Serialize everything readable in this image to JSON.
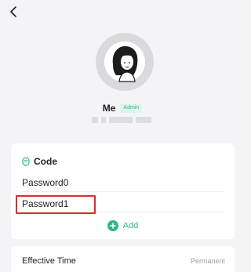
{
  "header": {
    "back_icon": "chevron-left-icon"
  },
  "profile": {
    "name": "Me",
    "role_badge": "Admin",
    "avatar_icon": "user-avatar-icon"
  },
  "code_section": {
    "title": "Code",
    "title_icon": "code-status-icon",
    "passwords": [
      "Password0",
      "Password1"
    ],
    "add_label": "Add",
    "add_icon": "plus-circle-icon"
  },
  "effective_time": {
    "label": "Effective Time",
    "value": "Permanent"
  },
  "colors": {
    "accent": "#2fb88a",
    "highlight_border": "#e02b2b",
    "background": "#f4f4f6"
  }
}
